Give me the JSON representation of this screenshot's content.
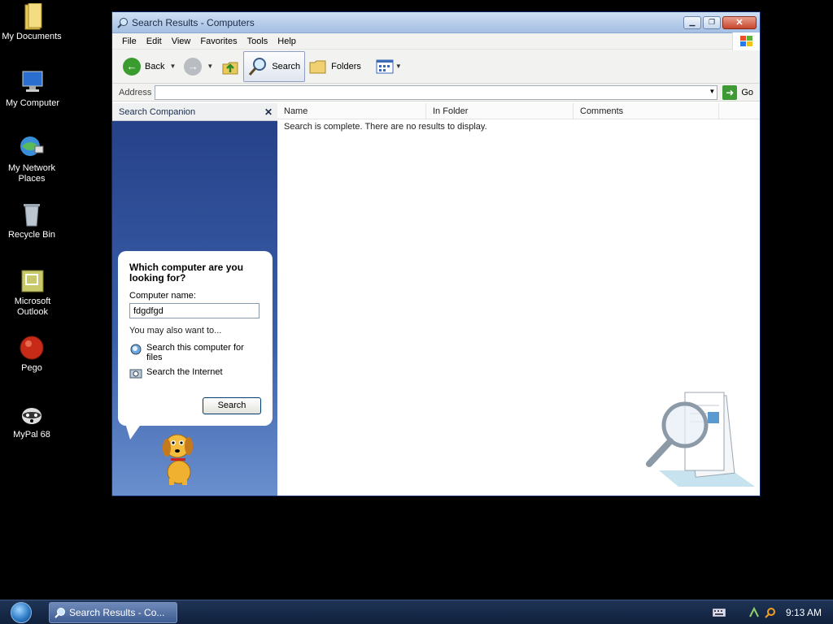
{
  "desktop": {
    "icons": [
      {
        "label": "My Documents",
        "icon": "folder-icon"
      },
      {
        "label": "My Computer",
        "icon": "computer-icon"
      },
      {
        "label": "My Network Places",
        "icon": "network-icon"
      },
      {
        "label": "Recycle Bin",
        "icon": "recycle-bin-icon"
      },
      {
        "label": "Microsoft Outlook",
        "icon": "outlook-icon"
      },
      {
        "label": "Pego",
        "icon": "pego-icon"
      },
      {
        "label": "MyPal 68",
        "icon": "mypal-icon"
      }
    ]
  },
  "window": {
    "title": "Search Results - Computers",
    "menu": [
      "File",
      "Edit",
      "View",
      "Favorites",
      "Tools",
      "Help"
    ],
    "toolbar": {
      "back": "Back",
      "search": "Search",
      "folders": "Folders"
    },
    "address": {
      "label": "Address",
      "value": "",
      "go": "Go"
    },
    "companion": {
      "header": "Search Companion",
      "question": "Which computer are you looking for?",
      "computer_name_label": "Computer name:",
      "computer_name_value": "fdgdfgd",
      "also_text": "You may also want to...",
      "links": [
        "Search this computer for files",
        "Search the Internet"
      ],
      "search_button": "Search"
    },
    "results": {
      "columns": [
        "Name",
        "In Folder",
        "Comments"
      ],
      "message": "Search is complete. There are no results to display."
    }
  },
  "taskbar": {
    "task_label": "Search Results - Co...",
    "clock": "9:13 AM"
  },
  "colors": {
    "companion_bg": "#2f4f98",
    "titlebar": "#b4cbe8",
    "taskbar": "#1a2c4c"
  }
}
